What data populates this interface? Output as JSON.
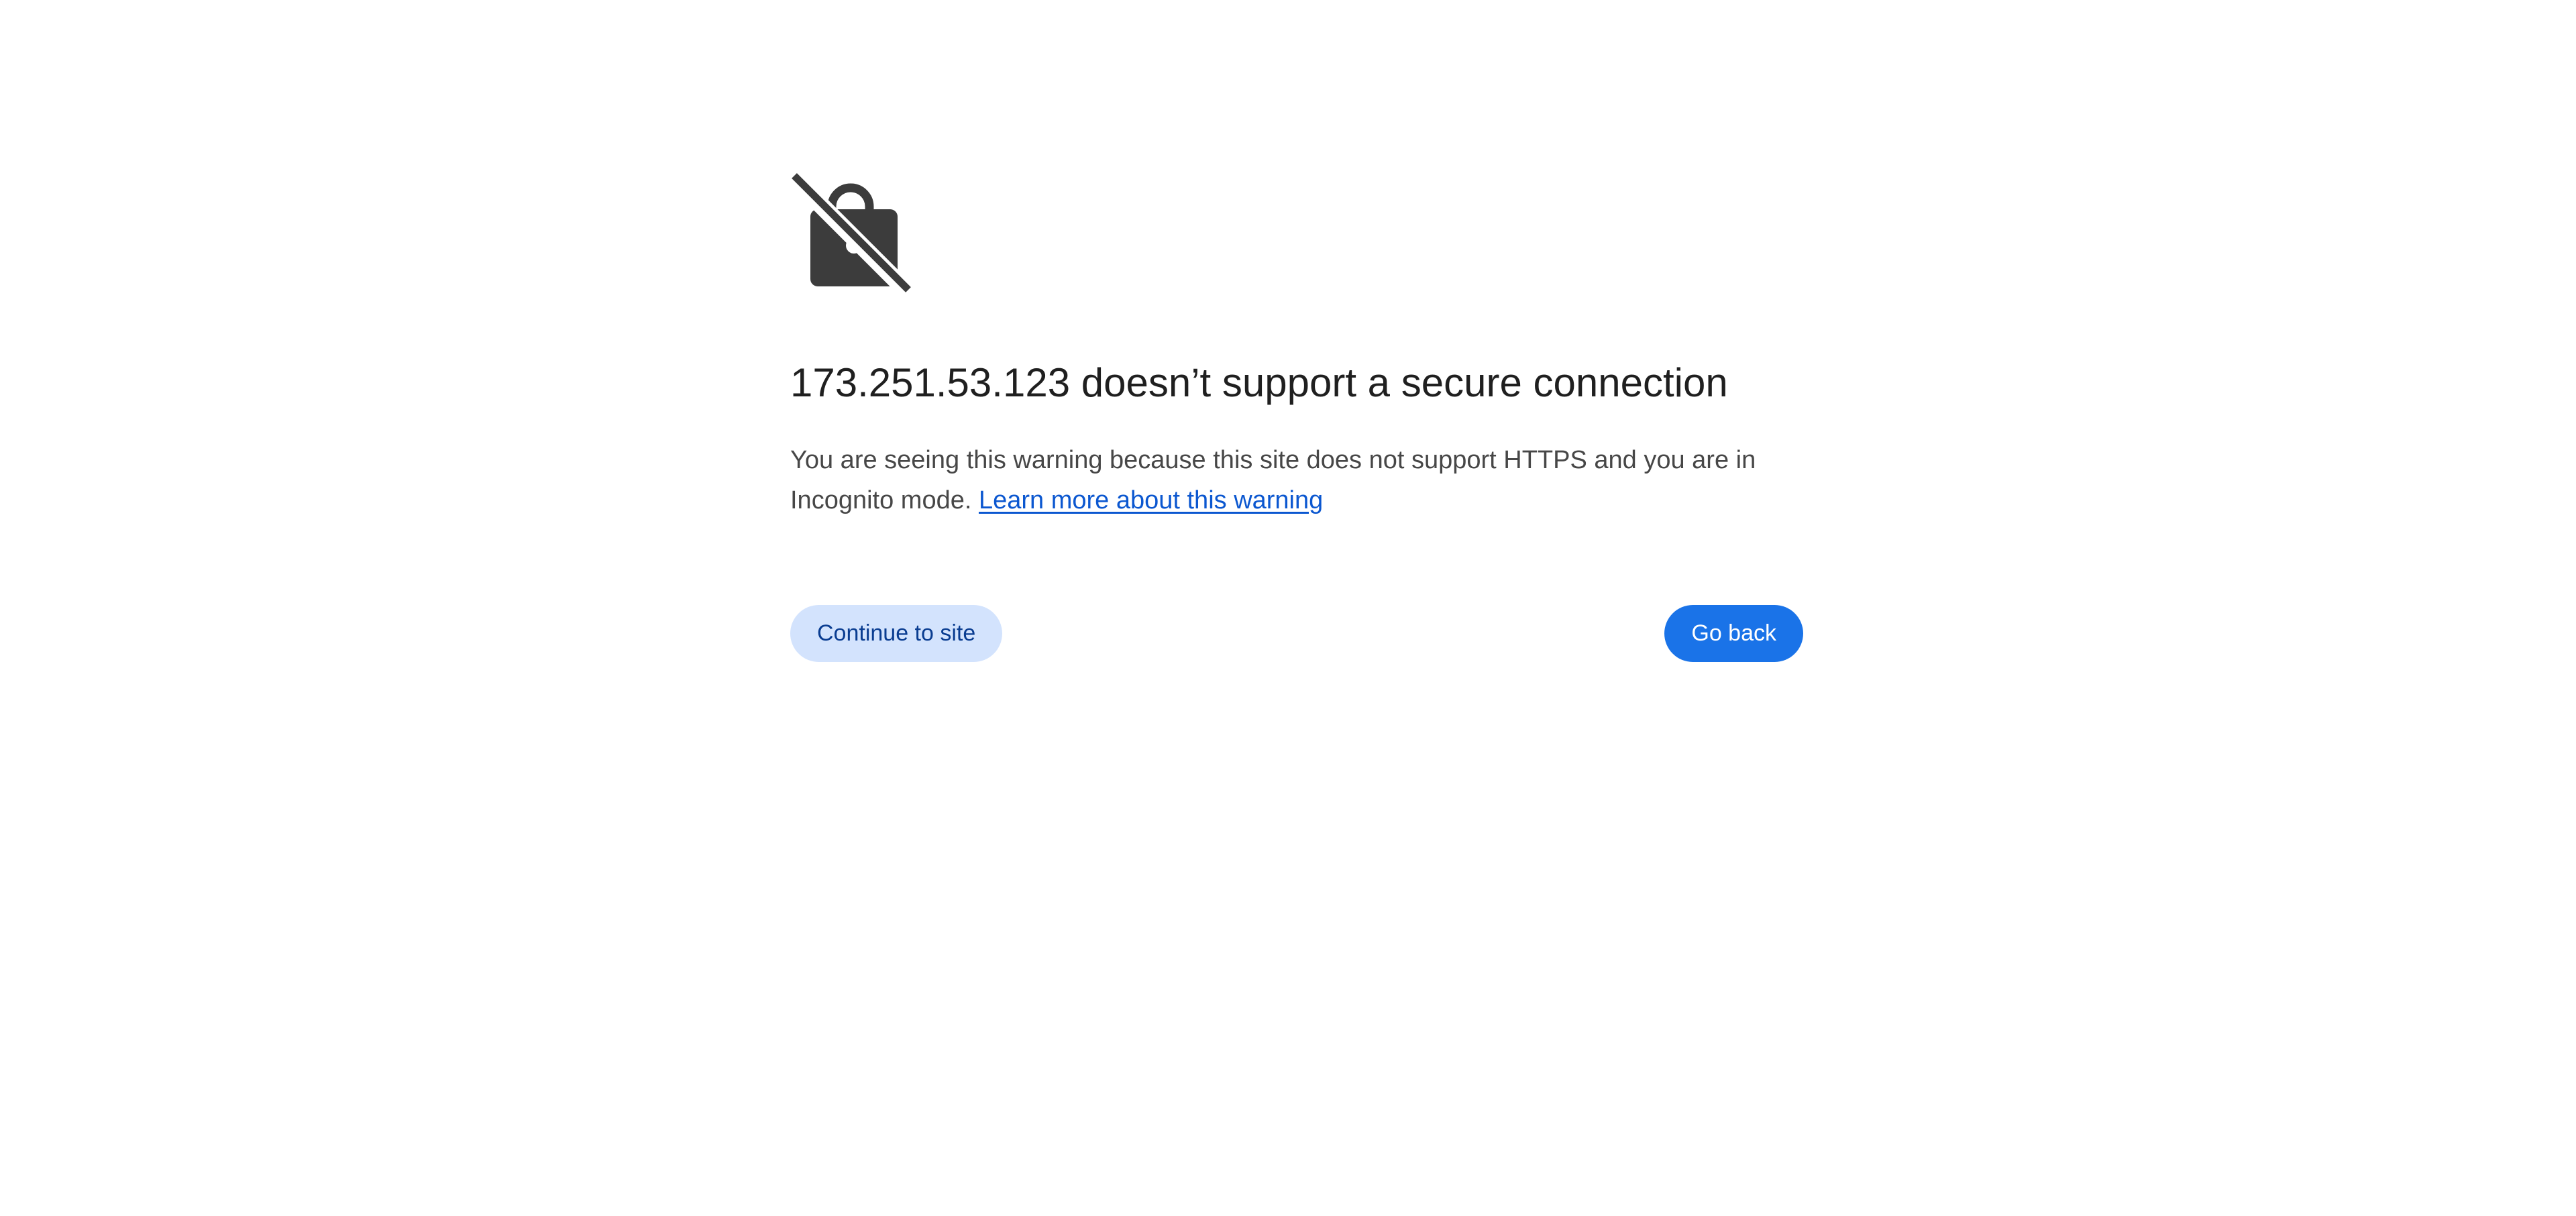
{
  "interstitial": {
    "icon": "lock-slash-icon",
    "heading": "173.251.53.123 doesn’t support a secure connection",
    "explanation": "You are seeing this warning because this site does not support HTTPS and you are in Incognito mode.",
    "learn_more_link": "Learn more about this warning",
    "continue_button": "Continue to site",
    "go_back_button": "Go back"
  },
  "colors": {
    "icon": "#3c3c3c",
    "heading": "#1f1f1f",
    "body_text": "#474747",
    "link": "#0b57d0",
    "secondary_button_bg": "#d3e3fd",
    "primary_button_bg": "#1a73e8"
  }
}
